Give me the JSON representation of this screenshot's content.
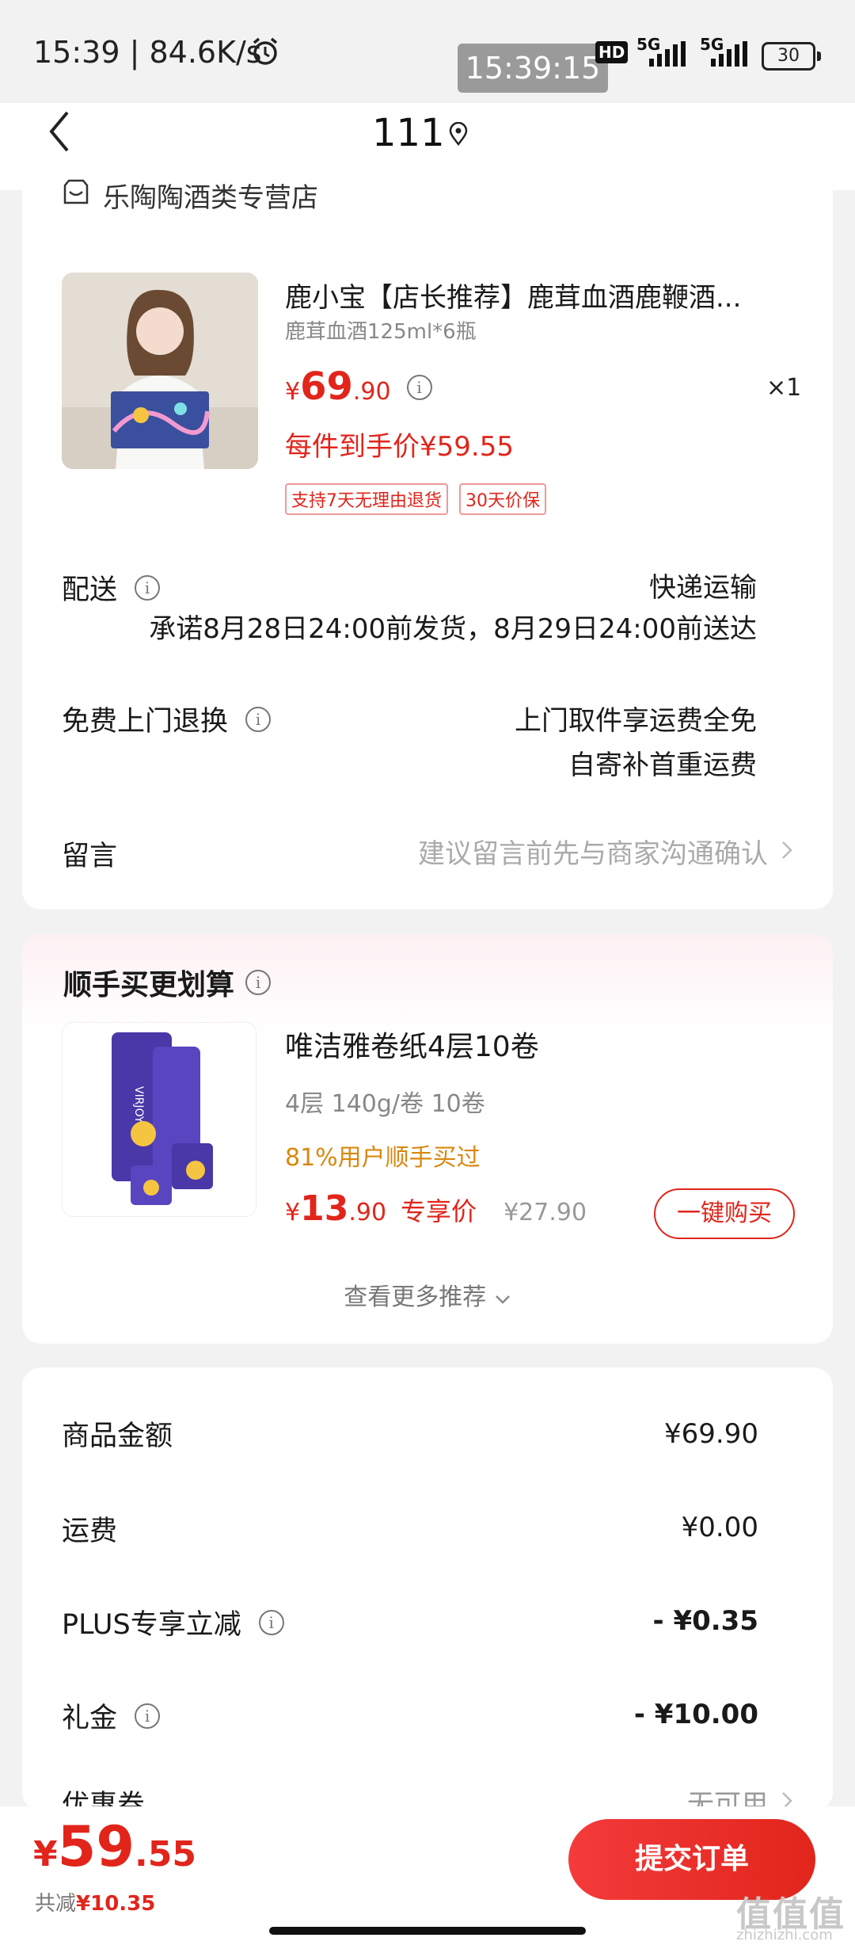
{
  "status_bar": {
    "time_speed": "15:39 | 84.6K/s",
    "clock_overlay": "15:39:15",
    "hd_label": "HD",
    "net1": "5G",
    "net2": "5G",
    "battery": "30"
  },
  "header": {
    "title": "111"
  },
  "shop": {
    "name": "乐陶陶酒类专营店"
  },
  "product": {
    "title": "鹿小宝【店长推荐】鹿茸血酒鹿鞭酒...",
    "spec": "鹿茸血酒125ml*6瓶",
    "currency": "¥",
    "price_int": "69",
    "price_dec": ".90",
    "qty": "×1",
    "net_price": "每件到手价¥59.55",
    "tags": [
      "支持7天无理由退货",
      "30天价保"
    ]
  },
  "delivery": {
    "label": "配送",
    "method": "快递运输",
    "promise": "承诺8月28日24:00前发货，8月29日24:00前送达"
  },
  "returns": {
    "label": "免费上门退换",
    "line1": "上门取件享运费全免",
    "line2": "自寄补首重运费"
  },
  "message": {
    "label": "留言",
    "placeholder": "建议留言前先与商家沟通确认"
  },
  "recommend": {
    "title": "顺手买更划算",
    "item_title": "唯洁雅卷纸4层10卷",
    "item_spec": "4层 140g/卷 10卷",
    "item_social": "81%用户顺手买过",
    "currency": "¥",
    "item_price_int": "13",
    "item_price_dec": ".90",
    "item_price_label": "专享价",
    "item_orig_price": "¥27.90",
    "buy_label": "一键购买",
    "more_label": "查看更多推荐"
  },
  "summary": {
    "rows": [
      {
        "label": "商品金额",
        "value": "¥69.90"
      },
      {
        "label": "运费",
        "value": "¥0.00"
      },
      {
        "label": "PLUS专享立减",
        "value": "- ¥0.35"
      },
      {
        "label": "礼金",
        "value": "- ¥10.00"
      },
      {
        "label": "优惠券",
        "value": "无可用"
      }
    ]
  },
  "footer": {
    "currency": "¥",
    "total_int": "59",
    "total_dec": ".55",
    "saved_label": "共减",
    "saved_value": "¥10.35",
    "submit_label": "提交订单"
  },
  "watermark": {
    "text": "值值值",
    "sub": "zhizhizhi.com"
  },
  "colors": {
    "accent": "#e1251b",
    "social": "#d9880f"
  }
}
